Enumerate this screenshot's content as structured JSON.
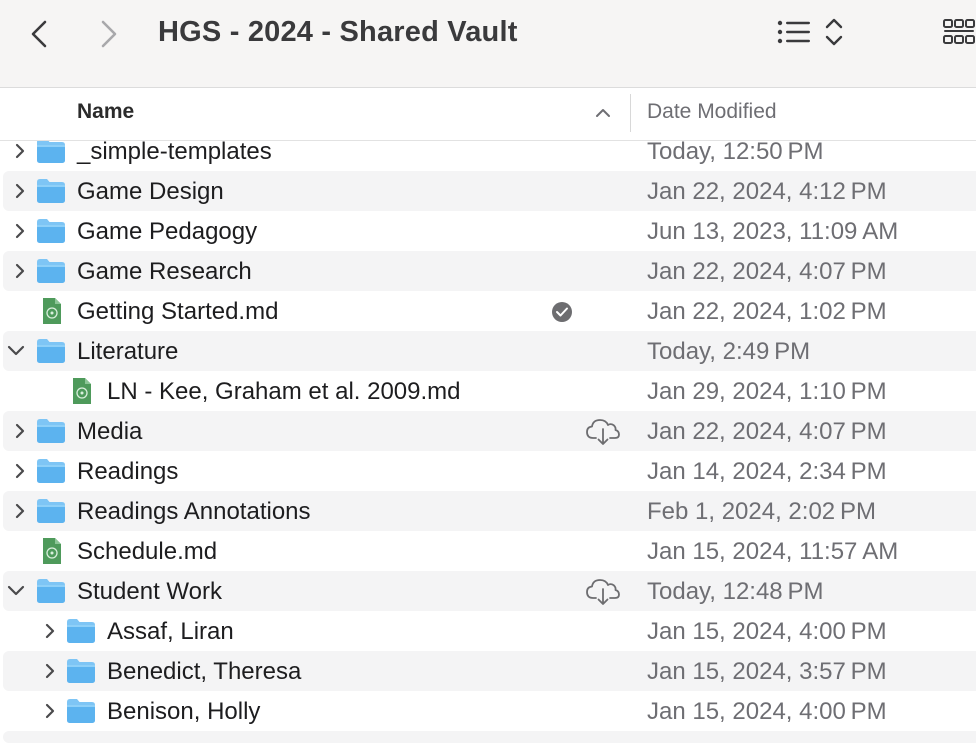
{
  "window": {
    "title": "HGS - 2024 - Shared Vault"
  },
  "columns": {
    "name": "Name",
    "date_modified": "Date Modified"
  },
  "rows": [
    {
      "name": "_simple-templates",
      "date": "Today, 12:50 PM",
      "type": "folder",
      "level": 0,
      "expanded": false,
      "status": ""
    },
    {
      "name": "Game Design",
      "date": "Jan 22, 2024, 4:12 PM",
      "type": "folder",
      "level": 0,
      "expanded": false,
      "status": ""
    },
    {
      "name": "Game Pedagogy",
      "date": "Jun 13, 2023, 11:09 AM",
      "type": "folder",
      "level": 0,
      "expanded": false,
      "status": ""
    },
    {
      "name": "Game Research",
      "date": "Jan 22, 2024, 4:07 PM",
      "type": "folder",
      "level": 0,
      "expanded": false,
      "status": ""
    },
    {
      "name": "Getting Started.md",
      "date": "Jan 22, 2024, 1:02 PM",
      "type": "file",
      "level": 0,
      "expanded": false,
      "status": "downloaded"
    },
    {
      "name": "Literature",
      "date": "Today, 2:49 PM",
      "type": "folder",
      "level": 0,
      "expanded": true,
      "status": ""
    },
    {
      "name": "LN - Kee, Graham et al. 2009.md",
      "date": "Jan 29, 2024, 1:10 PM",
      "type": "file",
      "level": 1,
      "expanded": false,
      "status": ""
    },
    {
      "name": "Media",
      "date": "Jan 22, 2024, 4:07 PM",
      "type": "folder",
      "level": 0,
      "expanded": false,
      "status": "cloud"
    },
    {
      "name": "Readings",
      "date": "Jan 14, 2024, 2:34 PM",
      "type": "folder",
      "level": 0,
      "expanded": false,
      "status": ""
    },
    {
      "name": "Readings Annotations",
      "date": "Feb 1, 2024, 2:02 PM",
      "type": "folder",
      "level": 0,
      "expanded": false,
      "status": ""
    },
    {
      "name": "Schedule.md",
      "date": "Jan 15, 2024, 11:57 AM",
      "type": "file",
      "level": 0,
      "expanded": false,
      "status": ""
    },
    {
      "name": "Student Work",
      "date": "Today, 12:48 PM",
      "type": "folder",
      "level": 0,
      "expanded": true,
      "status": "cloud"
    },
    {
      "name": "Assaf, Liran",
      "date": "Jan 15, 2024, 4:00 PM",
      "type": "folder",
      "level": 1,
      "expanded": false,
      "status": ""
    },
    {
      "name": "Benedict, Theresa",
      "date": "Jan 15, 2024, 3:57 PM",
      "type": "folder",
      "level": 1,
      "expanded": false,
      "status": ""
    },
    {
      "name": "Benison, Holly",
      "date": "Jan 15, 2024, 4:00 PM",
      "type": "folder",
      "level": 1,
      "expanded": false,
      "status": ""
    }
  ],
  "icons": {
    "back": "chevron-left-icon",
    "forward": "chevron-right-icon",
    "view": "list-view-icon",
    "sort": "sort-arrows-icon",
    "grid": "grid-view-icon"
  },
  "colors": {
    "folder": "#5cb3ef",
    "folder_tab": "#7ec5f5",
    "file": "#4e9a5b"
  }
}
